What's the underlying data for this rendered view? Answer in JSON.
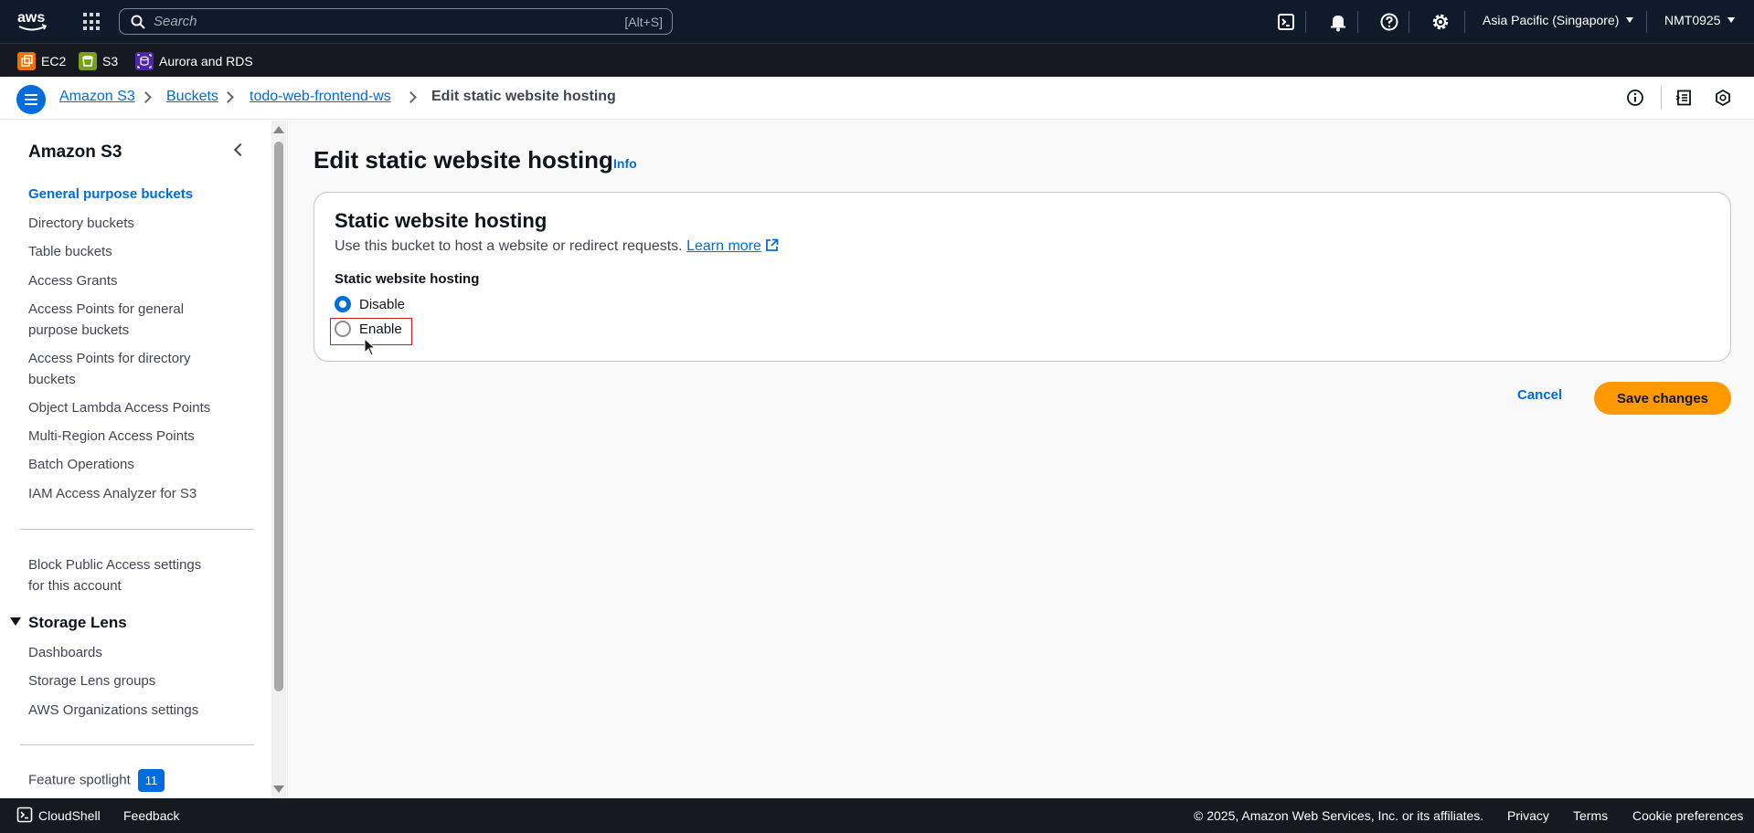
{
  "topnav": {
    "search_placeholder": "Search",
    "search_shortcut": "[Alt+S]",
    "region": "Asia Pacific (Singapore)",
    "account": "NMT0925",
    "icons": [
      "aws-logo",
      "services-grid-icon",
      "search-icon",
      "cloudshell-icon",
      "notifications-bell-icon",
      "help-icon",
      "settings-gear-icon"
    ]
  },
  "favorites": [
    {
      "label": "EC2",
      "color": "#ed7100"
    },
    {
      "label": "S3",
      "color": "#7aa116"
    },
    {
      "label": "Aurora and RDS",
      "color": "#4d27aa"
    }
  ],
  "breadcrumb": {
    "items": [
      "Amazon S3",
      "Buckets",
      "todo-web-frontend-ws"
    ],
    "current": "Edit static website hosting"
  },
  "sidebar": {
    "title": "Amazon S3",
    "items": [
      "General purpose buckets",
      "Directory buckets",
      "Table buckets",
      "Access Grants",
      "Access Points for general purpose buckets",
      "Access Points for directory buckets",
      "Object Lambda Access Points",
      "Multi-Region Access Points",
      "Batch Operations",
      "IAM Access Analyzer for S3"
    ],
    "block_public": "Block Public Access settings for this account",
    "storage_lens": {
      "title": "Storage Lens",
      "items": [
        "Dashboards",
        "Storage Lens groups",
        "AWS Organizations settings"
      ]
    },
    "feature_spotlight": "Feature spotlight",
    "feature_count": "11"
  },
  "main": {
    "title": "Edit static website hosting",
    "info": "Info",
    "card": {
      "title": "Static website hosting",
      "description": "Use this bucket to host a website or redirect requests.",
      "learn_more": "Learn more",
      "field_label": "Static website hosting",
      "options": [
        "Disable",
        "Enable"
      ],
      "selected": "Disable"
    },
    "cancel": "Cancel",
    "save": "Save changes"
  },
  "footer": {
    "cloudshell": "CloudShell",
    "feedback": "Feedback",
    "copyright": "© 2025, Amazon Web Services, Inc. or its affiliates.",
    "privacy": "Privacy",
    "terms": "Terms",
    "cookies": "Cookie preferences"
  },
  "colors": {
    "accent": "#006ce0",
    "primary_button": "#ff9900",
    "nav_bg": "#0f1b2a"
  }
}
